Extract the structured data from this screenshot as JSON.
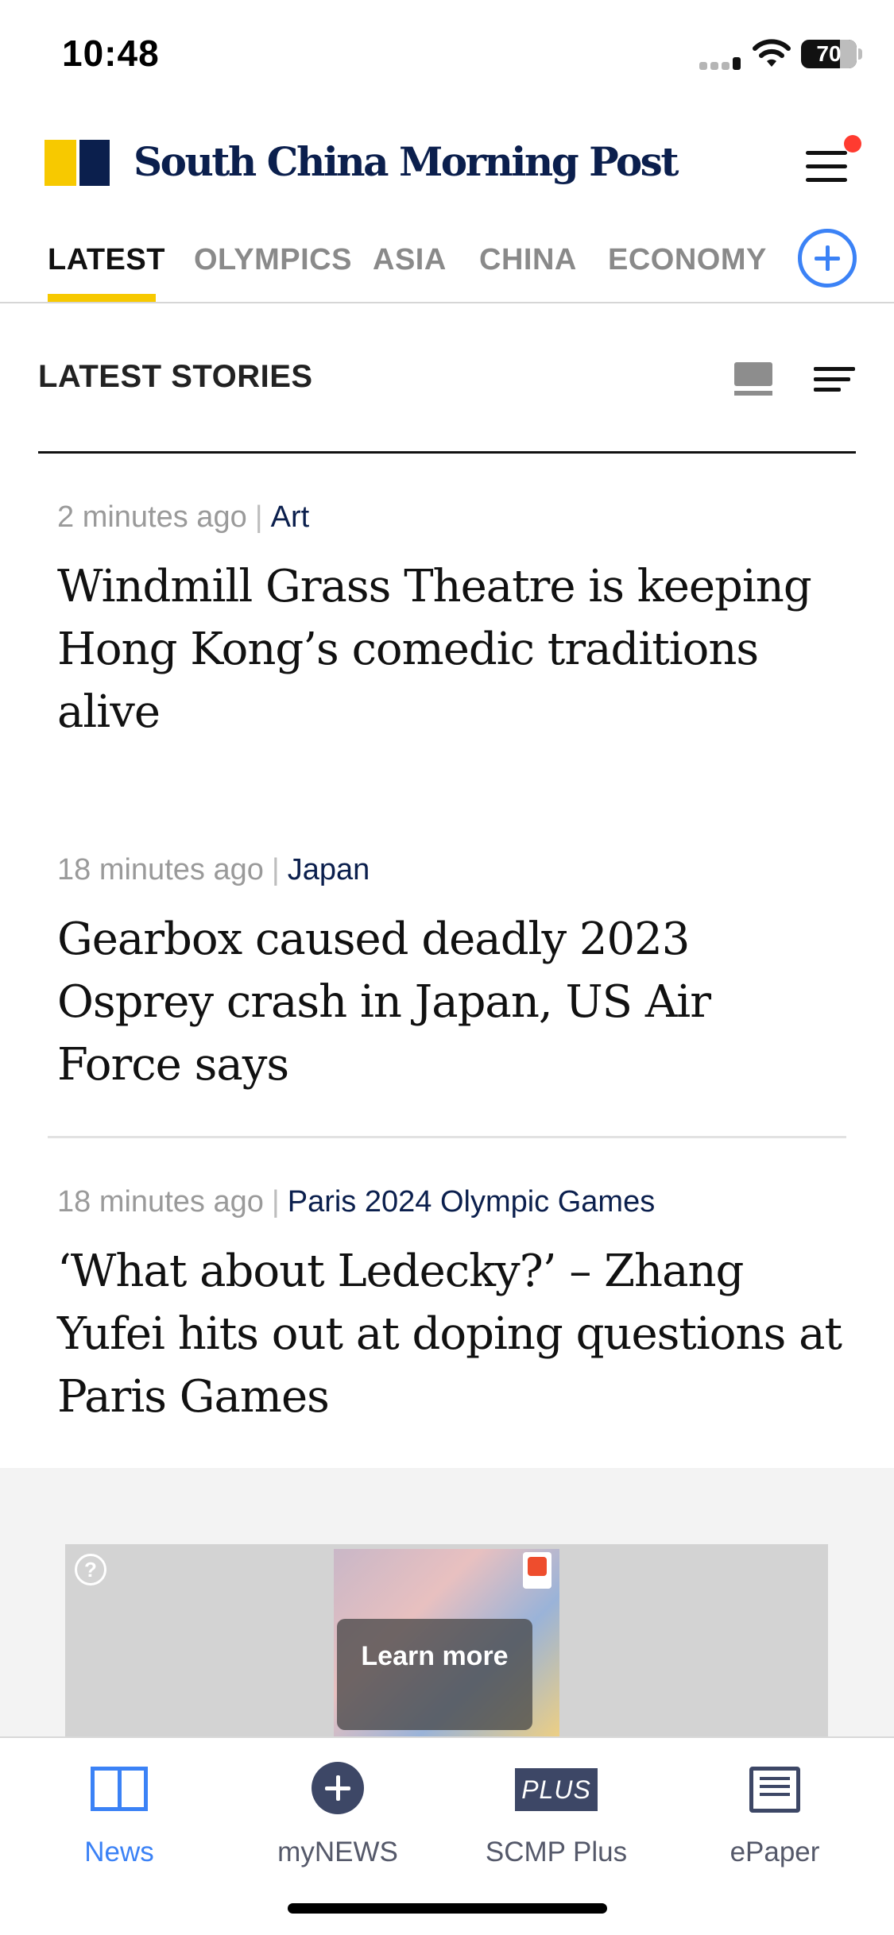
{
  "status_bar": {
    "time": "10:48",
    "battery": "70",
    "battery_level": 0.7
  },
  "header": {
    "brand": "South China Morning Post"
  },
  "tabs": [
    {
      "label": "LATEST",
      "active": true
    },
    {
      "label": "OLYMPICS",
      "active": false
    },
    {
      "label": "ASIA",
      "active": false
    },
    {
      "label": "CHINA",
      "active": false
    },
    {
      "label": "ECONOMY",
      "active": false
    }
  ],
  "section": {
    "title": "LATEST STORIES"
  },
  "articles": [
    {
      "time": "2 minutes ago",
      "category": "Art",
      "headline": "Windmill Grass Theatre is keeping Hong Kong’s comedic traditions alive"
    },
    {
      "time": "18 minutes ago",
      "category": "Japan",
      "headline": "Gearbox caused deadly 2023 Osprey crash in Japan, US Air Force says"
    },
    {
      "time": "18 minutes ago",
      "category": "Paris 2024 Olympic Games",
      "headline": "‘What about Ledecky?’ – Zhang Yufei hits out at doping questions at Paris Games"
    }
  ],
  "ad": {
    "info": "?",
    "cta": "Learn more"
  },
  "tabbar": [
    {
      "label": "News",
      "icon": "news-icon",
      "active": true
    },
    {
      "label": "myNEWS",
      "icon": "add-circle-icon",
      "active": false
    },
    {
      "label": "SCMP Plus",
      "icon": "plus-badge-icon",
      "icon_text": "PLUS",
      "active": false
    },
    {
      "label": "ePaper",
      "icon": "epaper-icon",
      "active": false
    }
  ],
  "colors": {
    "accent": "#3b82f6",
    "brand_yellow": "#f7c900",
    "brand_navy": "#0b1f4d",
    "notification": "#ff3b30"
  }
}
